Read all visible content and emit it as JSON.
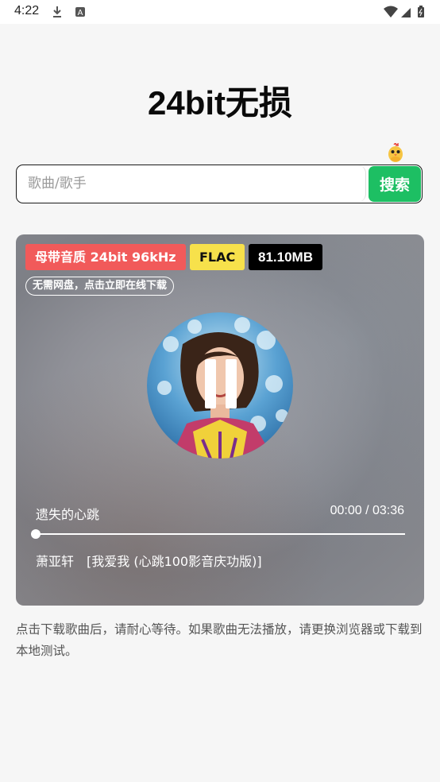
{
  "status_bar": {
    "time": "4:22",
    "left_icons": [
      "download-icon",
      "translate-icon"
    ],
    "right_icons": [
      "wifi-icon",
      "signal-icon",
      "battery-icon"
    ]
  },
  "app": {
    "title": "24bit无损"
  },
  "search": {
    "placeholder": "歌曲/歌手",
    "value": "",
    "button_label": "搜索",
    "button_color": "#1dbf63"
  },
  "player": {
    "badges": {
      "quality": "母带音质 24bit 96kHz",
      "format": "FLAC",
      "size": "81.10MB"
    },
    "online_tag": "无需网盘，点击立即在线下载",
    "song_title": "遗失的心跳",
    "time_display": "00:00 / 03:36",
    "progress": 0,
    "artist": "萧亚轩",
    "album": "[我爱我 (心跳100影音庆功版)]",
    "colors": {
      "quality_badge": "#f15a5a",
      "format_badge": "#f7e14b",
      "size_badge": "#000000"
    }
  },
  "notice": "点击下载歌曲后，请耐心等待。如果歌曲无法播放，请更换浏览器或下载到本地测试。"
}
